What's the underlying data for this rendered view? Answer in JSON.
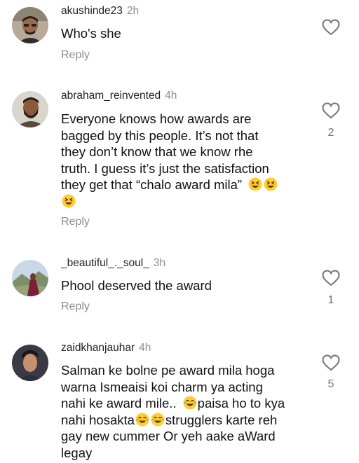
{
  "comments": [
    {
      "username": "akushinde23",
      "time": "2h",
      "lines": [
        "Who's she"
      ],
      "reply_label": "Reply",
      "likes": "",
      "avatar_icon": "user-avatar-man-glasses"
    },
    {
      "username": "abraham_reinvented",
      "time": "4h",
      "lines": [
        "Everyone knows how awards are",
        "bagged by this people. It’s not that",
        "they don’t know that we know rhe",
        "truth. I guess it’s just the satisfaction",
        "they get that “chalo award mila”"
      ],
      "reply_label": "Reply",
      "likes": "2",
      "avatar_icon": "user-avatar-bearded-man"
    },
    {
      "username": "_beautiful_._soul_",
      "time": "3h",
      "lines": [
        "Phool deserved the award"
      ],
      "reply_label": "Reply",
      "likes": "1",
      "avatar_icon": "user-avatar-landscape-woman"
    },
    {
      "username": "zaidkhanjauhar",
      "time": "4h",
      "lines": [
        "Salman ke bolne pe award mila hoga",
        "warna Ismeaisi koi charm ya acting",
        "nahi ke award mile..",
        "paisa ho to kya",
        "nahi hosakta",
        "strugglers karte reh",
        "gay new cummer Or yeh aake aWard",
        "legay"
      ],
      "reply_label": "",
      "likes": "5",
      "avatar_icon": "user-avatar-young-man"
    }
  ],
  "icons": {
    "heart": "heart-outline-icon",
    "emoji_laugh": "grinning-squinting-face-emoji",
    "emoji_tears": "face-with-tears-of-joy-emoji"
  },
  "colors": {
    "secondary_text": "#8e8e8e",
    "primary_text": "#111111",
    "emoji_yellow": "#ffcc33"
  }
}
